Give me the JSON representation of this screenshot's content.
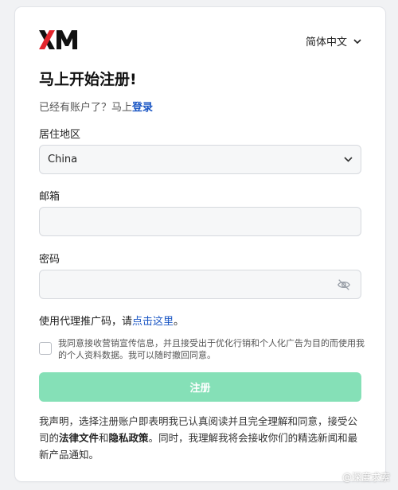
{
  "brand": {
    "logo_text": "XM",
    "logo_color": "#e3262d",
    "logo_dark": "#111111"
  },
  "header": {
    "language": "简体中文"
  },
  "form": {
    "title": "马上开始注册!",
    "have_account_prefix": "已经有账户了？马上",
    "login_link": "登录",
    "region_label": "居住地区",
    "region_value": "China",
    "email_label": "邮箱",
    "email_value": "",
    "password_label": "密码",
    "password_value": "",
    "referral_prefix": "使用代理推广码，请",
    "referral_link": "点击这里",
    "referral_suffix": "。",
    "consent_text": "我同意接收营销宣传信息，并且接受出于优化行销和个人化广告为目的而使用我的个人资料数据。我可以随时撤回同意。",
    "submit_label": "注册",
    "submit_color": "#85e0b7"
  },
  "declaration": {
    "part1": "我声明，选择注册账户即表明我已认真阅读并且完全理解和同意，接受公司的",
    "legal_docs": "法律文件",
    "and": "和",
    "privacy_policy": "隐私政策",
    "part2": "。同时，我理解我将会接收你们的精选新闻和最新产品通知。"
  },
  "watermark": {
    "text": "@深度求索"
  },
  "icons": [
    "chevron-down-icon",
    "eye-off-icon",
    "checkbox-icon"
  ]
}
